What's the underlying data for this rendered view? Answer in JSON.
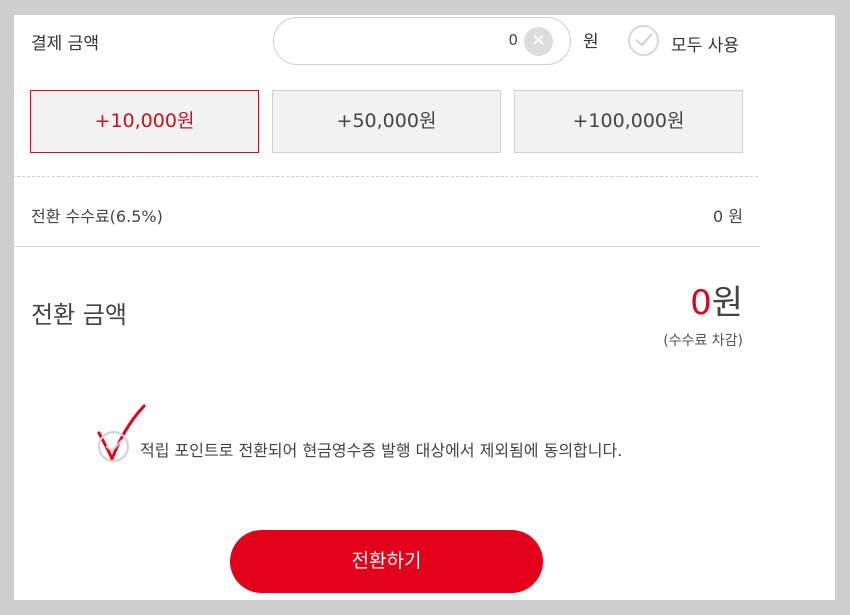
{
  "payment": {
    "label": "결제 금액",
    "amount_value": "0",
    "clear_icon": "close-icon",
    "unit": "원",
    "use_all_label": "모두 사용"
  },
  "amount_buttons": [
    {
      "label": "+10,000원",
      "selected": true
    },
    {
      "label": "+50,000원",
      "selected": false
    },
    {
      "label": "+100,000원",
      "selected": false
    }
  ],
  "fee": {
    "label": "전환 수수료(6.5%)",
    "value": "0 원"
  },
  "total": {
    "label": "전환 금액",
    "amount": "0",
    "unit": "원",
    "note": "(수수료 차감)"
  },
  "agreement": {
    "text": "적립 포인트로 전환되어 현금영수증 발행 대상에서 제외됨에 동의합니다.",
    "checked": false
  },
  "submit": {
    "label": "전환하기"
  },
  "colors": {
    "accent": "#e3001b",
    "selected_border": "#c8101e",
    "button_bg": "#f2f2f2"
  }
}
